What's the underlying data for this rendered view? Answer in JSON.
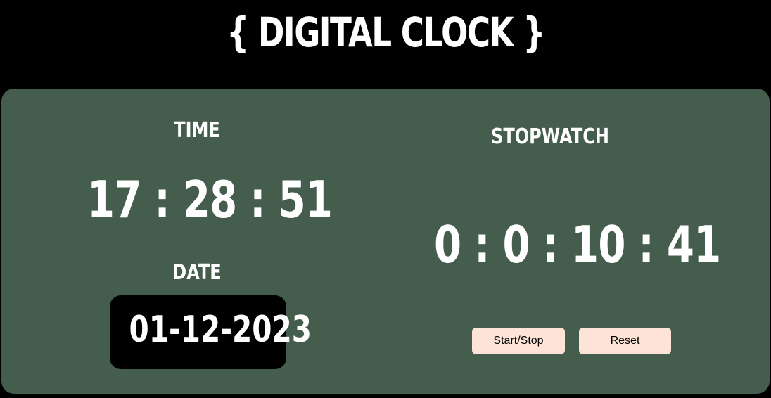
{
  "header": {
    "title": "{ DIGITAL CLOCK }"
  },
  "clock": {
    "time_label": "TIME",
    "time_value": "17 : 28 : 51",
    "date_label": "DATE",
    "date_value": "01-12-2023"
  },
  "stopwatch": {
    "label": "STOPWATCH",
    "value": "0 : 0 : 10 : 41",
    "start_stop_label": "Start/Stop",
    "reset_label": "Reset"
  },
  "colors": {
    "background": "#000000",
    "panel": "#455d4c",
    "button": "#fde4d6",
    "text": "#ffffff"
  }
}
